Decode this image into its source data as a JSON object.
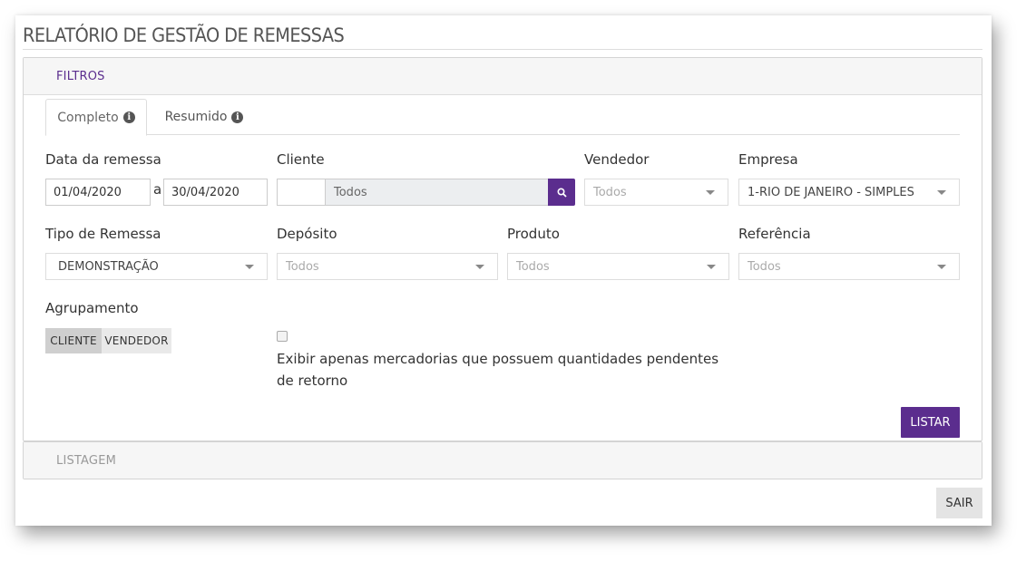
{
  "page": {
    "title": "RELATÓRIO DE GESTÃO DE REMESSAS"
  },
  "filters_panel": {
    "title": "FILTROS"
  },
  "tabs": [
    {
      "label": "Completo"
    },
    {
      "label": "Resumido"
    }
  ],
  "fields": {
    "data_remessa": {
      "label": "Data da remessa",
      "from": "01/04/2020",
      "separator": "a",
      "to": "30/04/2020"
    },
    "cliente": {
      "label": "Cliente",
      "code": "",
      "name": "Todos"
    },
    "vendedor": {
      "label": "Vendedor",
      "value": "Todos"
    },
    "empresa": {
      "label": "Empresa",
      "value": "1-RIO DE JANEIRO - SIMPLES"
    },
    "tipo_remessa": {
      "label": "Tipo de Remessa",
      "value": "DEMONSTRAÇÃO"
    },
    "deposito": {
      "label": "Depósito",
      "value": "Todos"
    },
    "produto": {
      "label": "Produto",
      "value": "Todos"
    },
    "referencia": {
      "label": "Referência",
      "value": "Todos"
    },
    "agrupamento": {
      "label": "Agrupamento",
      "options": [
        "CLIENTE",
        "VENDEDOR"
      ],
      "selected": "CLIENTE"
    },
    "pendentes": {
      "label": "Exibir apenas mercadorias que possuem quantidades pendentes de retorno",
      "checked": false
    }
  },
  "buttons": {
    "listar": "LISTAR",
    "sair": "SAIR"
  },
  "listing_panel": {
    "title": "LISTAGEM"
  },
  "colors": {
    "accent": "#5b2d8e",
    "panel_header_bg": "#f6f6f6"
  }
}
